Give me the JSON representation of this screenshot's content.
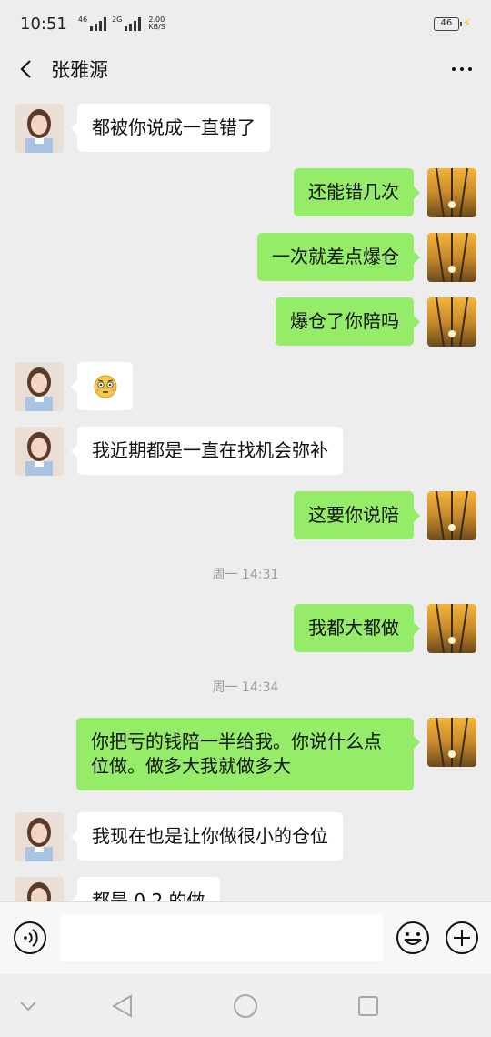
{
  "status_bar": {
    "time": "10:51",
    "signal1_label": "46",
    "signal2_label": "2G",
    "net_speed": "2.00",
    "net_speed_unit": "KB/S",
    "battery": "46"
  },
  "header": {
    "title": "张雅源"
  },
  "messages": [
    {
      "from": "them",
      "text": "都被你说成一直错了"
    },
    {
      "from": "me",
      "text": "还能错几次"
    },
    {
      "from": "me",
      "text": "一次就差点爆仓"
    },
    {
      "from": "me",
      "text": "爆仓了你陪吗"
    },
    {
      "from": "them",
      "emoji": "flushed-face"
    },
    {
      "from": "them",
      "text": "我近期都是一直在找机会弥补"
    },
    {
      "from": "me",
      "text": "这要你说陪"
    },
    {
      "timestamp": "周一 14:31"
    },
    {
      "from": "me",
      "text": "我都大都做"
    },
    {
      "timestamp": "周一 14:34"
    },
    {
      "from": "me",
      "text": "你把亏的钱陪一半给我。你说什么点位做。做多大我就做多大"
    },
    {
      "from": "them",
      "text": "我现在也是让你做很小的仓位"
    },
    {
      "from": "them",
      "text": "都是 0.2 的做"
    }
  ],
  "input": {
    "value": "",
    "placeholder": ""
  },
  "colors": {
    "sent_bubble": "#95ec69",
    "received_bubble": "#ffffff",
    "background": "#ededed"
  },
  "icons": {
    "back": "chevron-left-icon",
    "more": "more-dots-icon",
    "voice": "voice-icon",
    "emoji": "emoji-icon",
    "plus": "plus-icon",
    "nav_down": "chevron-down-icon",
    "nav_back": "triangle-back-icon",
    "nav_home": "circle-home-icon",
    "nav_recent": "square-recent-icon"
  }
}
